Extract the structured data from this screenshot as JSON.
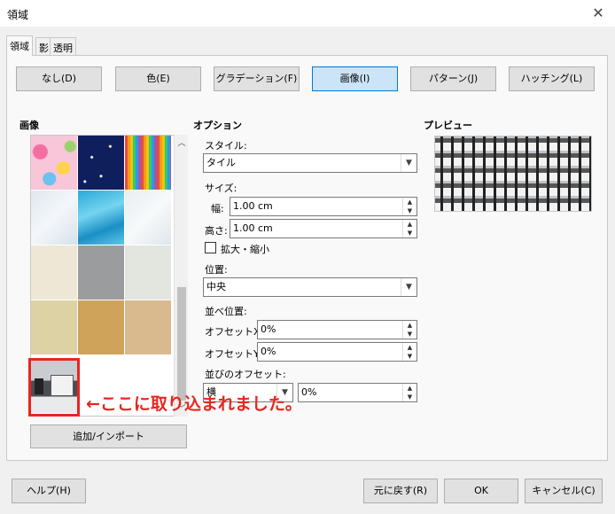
{
  "window": {
    "title": "領域",
    "close_glyph": "✕"
  },
  "tabs": [
    {
      "label": "領域",
      "active": true
    },
    {
      "label": "影",
      "active": false
    },
    {
      "label": "透明",
      "active": false
    }
  ],
  "fill_types": [
    {
      "label": "なし(D)",
      "active": false
    },
    {
      "label": "色(E)",
      "active": false
    },
    {
      "label": "グラデーション(F)",
      "active": false
    },
    {
      "label": "画像(I)",
      "active": true
    },
    {
      "label": "パターン(J)",
      "active": false
    },
    {
      "label": "ハッチング(L)",
      "active": false
    }
  ],
  "image_section": {
    "heading": "画像",
    "add_import_label": "追加/インポート"
  },
  "options": {
    "heading": "オプション",
    "style_label": "スタイル:",
    "style_value": "タイル",
    "size_label": "サイズ:",
    "width_label": "幅:",
    "width_value": "1.00 cm",
    "height_label": "高さ:",
    "height_value": "1.00 cm",
    "scale_label": "拡大・縮小",
    "position_label": "位置:",
    "position_value": "中央",
    "tile_position_label": "並べ位置:",
    "offset_x_label": "オフセットX:",
    "offset_x_value": "0%",
    "offset_y_label": "オフセットY:",
    "offset_y_value": "0%",
    "tile_offset_label": "並びのオフセット:",
    "tile_offset_dir_value": "横",
    "tile_offset_value": "0%"
  },
  "preview": {
    "heading": "プレビュー"
  },
  "annotation": {
    "text": "←ここに取り込まれました。",
    "color": "#e8261e"
  },
  "footer": {
    "help_label": "ヘルプ(H)",
    "reset_label": "元に戻す(R)",
    "ok_label": "OK",
    "cancel_label": "キャンセル(C)"
  },
  "colors": {
    "accent": "#0078d7",
    "highlight_box": "#e8261e"
  }
}
